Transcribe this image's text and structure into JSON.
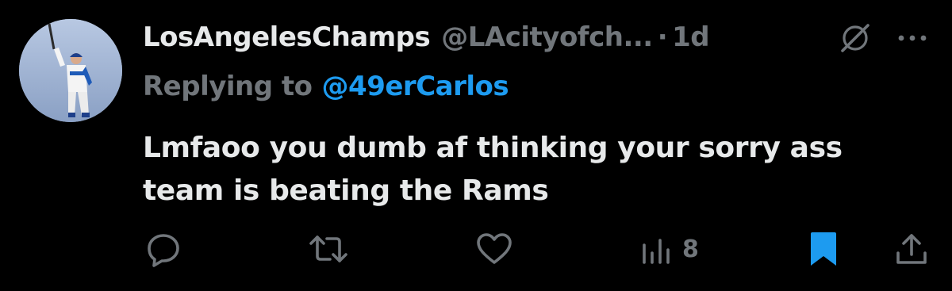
{
  "tweet": {
    "author": {
      "display_name": "LosAngelesChamps",
      "handle": "@LAcityofch...",
      "avatar": "baseball-player-avatar"
    },
    "separator": "·",
    "time": "1d",
    "replying_to": {
      "label": "Replying to",
      "handle": "@49erCarlos"
    },
    "text_line_1": "Lmfaoo you dumb af thinking your sorry ass",
    "text_line_2": "team is beating the Rams"
  },
  "actions": {
    "reply_icon": "reply-icon",
    "retweet_icon": "retweet-icon",
    "like_icon": "heart-icon",
    "views_icon": "views-icon",
    "views_count": "8",
    "bookmark_icon": "bookmark-icon",
    "share_icon": "share-icon"
  },
  "colors": {
    "background": "#000000",
    "primary_text": "#e7e9ea",
    "secondary_text": "#71767b",
    "accent": "#1d9bf0"
  }
}
